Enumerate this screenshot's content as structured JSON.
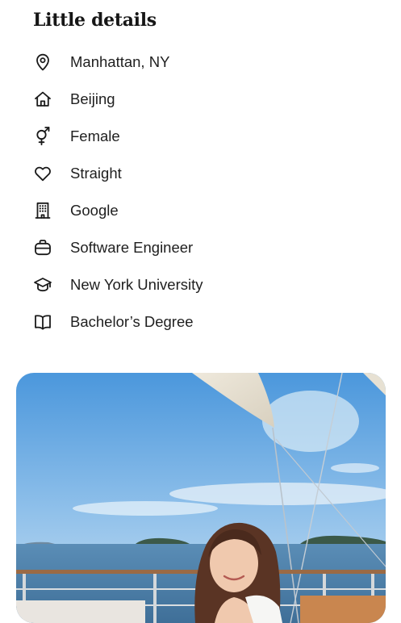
{
  "section": {
    "title": "Little details"
  },
  "details": [
    {
      "icon": "location-pin-icon",
      "label": "Manhattan, NY"
    },
    {
      "icon": "home-icon",
      "label": "Beijing"
    },
    {
      "icon": "gender-icon",
      "label": "Female"
    },
    {
      "icon": "heart-icon",
      "label": "Straight"
    },
    {
      "icon": "building-icon",
      "label": "Google"
    },
    {
      "icon": "briefcase-icon",
      "label": "Software Engineer"
    },
    {
      "icon": "graduation-cap-icon",
      "label": "New York University"
    },
    {
      "icon": "book-icon",
      "label": "Bachelor’s Degree"
    }
  ],
  "photo": {
    "subject": "profile-photo"
  }
}
